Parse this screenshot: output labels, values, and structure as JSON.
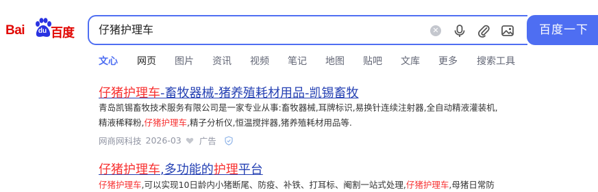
{
  "logo": {
    "bai": "Bai",
    "du": "du",
    "cn": "百度"
  },
  "search": {
    "query": "仔猪护理车",
    "button_label": "百度一下"
  },
  "tabs": [
    {
      "label": "文心",
      "icon": ""
    },
    {
      "label": "网页"
    },
    {
      "label": "图片"
    },
    {
      "label": "资讯"
    },
    {
      "label": "视频"
    },
    {
      "label": "笔记"
    },
    {
      "label": "地图"
    },
    {
      "label": "贴吧"
    },
    {
      "label": "文库"
    },
    {
      "label": "更多"
    },
    {
      "label": "搜索工具"
    }
  ],
  "results": [
    {
      "title_hl": "仔猪护理车",
      "title_rest": "-畜牧器械-猪养殖耗材用品-凯锡畜牧",
      "snippet_line1": "青岛凯锡畜牧技术服务有限公司是一家专业从事:畜牧器械,耳牌标识,易换针连续注射器,全自动精液灌装机,",
      "snippet_line2_pre": "精液稀释粉,",
      "snippet_line2_hl": "仔猪护理车",
      "snippet_line2_post": ",精子分析仪,恒温搅拌器,猪养殖耗材用品等.",
      "source": "网商网科技",
      "date": "2026-03",
      "ad_label": "广告"
    },
    {
      "title_hl": "仔猪护理车",
      "title_mid": ",多功能的",
      "title_hl2": "护理",
      "title_rest": "平台",
      "snippet_hl": "仔猪护理车",
      "snippet_mid": ",可以实现10日龄内小猪断尾、防疫、补铁、打耳标、阉割一站式处理,",
      "snippet_hl2": "仔猪护理车",
      "snippet_post": ",母猪日常防"
    }
  ],
  "colors": {
    "accent": "#4e6ef2",
    "link": "#2440b3",
    "highlight": "#f73131",
    "logo_red": "#e10602"
  }
}
